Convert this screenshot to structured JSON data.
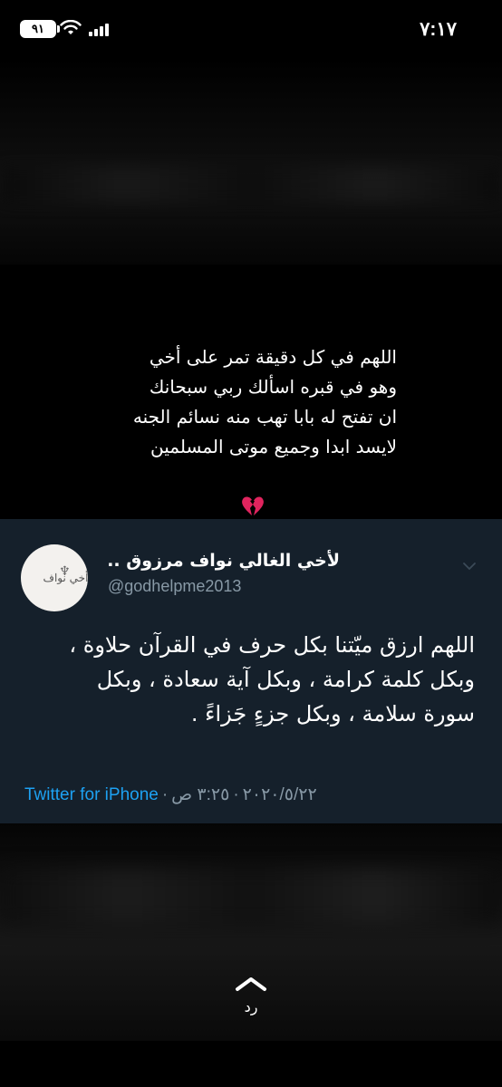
{
  "status_bar": {
    "time": "٧:١٧",
    "battery_level": "٩١"
  },
  "caption": {
    "lines": [
      "اللهم في كل دقيقة تمر على أخي",
      "وهو في قبره اسألك ربي سبحانك",
      "ان تفتح له بابا تهب منه نسائم الجنه",
      "لايسد ابدا وجميع موتى المسلمين"
    ],
    "emoji": "broken-heart"
  },
  "tweet": {
    "display_name": "لأخي الغالي نواف مرزوق ..",
    "handle": "@godhelpme2013",
    "avatar_text": "لك أخي نواف",
    "body_lines": [
      "اللهم ارزق ميّتنا بكل حرف في القرآن حلاوة ،",
      "وبكل كلمة كرامة ، وبكل آية سعادة ، وبكل",
      "سورة سلامة ، وبكل جزءٍ جَزاءً ."
    ],
    "source": "Twitter for iPhone",
    "separator": "·",
    "date": "٢٠٢٠/٥/٢٢",
    "time": "٣:٢٥ ص"
  },
  "reply": {
    "label": "رد"
  },
  "colors": {
    "background": "#000000",
    "tweet_card": "#15202b",
    "link": "#1da1f2",
    "secondary_text": "#8899a6",
    "heart": "#e0245e"
  },
  "icons": {
    "wifi": "wifi-icon",
    "signal": "signal-icon",
    "battery": "battery-icon",
    "caret": "chevron-down-icon",
    "reply": "chevron-up-icon",
    "heart": "broken-heart-icon"
  }
}
